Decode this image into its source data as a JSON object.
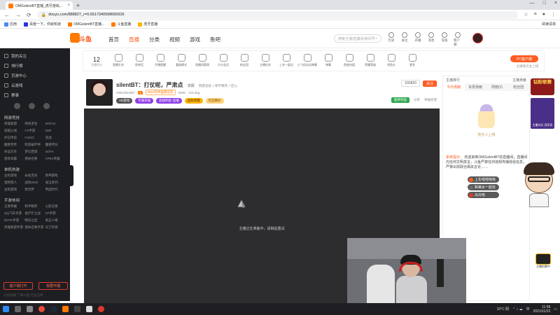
{
  "browser": {
    "tab_title": "OMGsilentBT直播_虎牙游戏...",
    "url": "douyu.com/888827_r=0.6517340598065926",
    "bookmarks": [
      "应用",
      "百度一下，你就知道",
      "OMGsilentBT直播...",
      "斗鱼直播",
      "虎牙直播"
    ],
    "reading_list": "阅读清单"
  },
  "header": {
    "logo": "斗鱼",
    "nav": [
      "首页",
      "直播",
      "分类",
      "视频",
      "游戏",
      "鱼吧"
    ],
    "search_placeholder": "搜索主播/直播间/房间号",
    "icons": [
      {
        "label": "历史",
        "icon": "history-icon"
      },
      {
        "label": "关注",
        "icon": "follow-icon"
      },
      {
        "label": "开播",
        "icon": "broadcast-icon"
      },
      {
        "label": "消息",
        "icon": "message-icon"
      },
      {
        "label": "充值",
        "icon": "wallet-icon"
      },
      {
        "label": "客户端",
        "icon": "client-icon"
      }
    ]
  },
  "sidebar": {
    "items": [
      "我的关注",
      "排行榜",
      "页游中心",
      "云游戏",
      "赛事"
    ],
    "sec_hot": "网游竞技",
    "hot_games": [
      "英雄联盟",
      "绝地求生",
      "DOTA2",
      "穿越火线",
      "CF手游",
      "DNF",
      "炉石传说",
      "CSGO",
      "逆战",
      "魔兽世界",
      "暗黑破坏神",
      "魔兽怀旧",
      "命运方舟",
      "梦幻西游",
      "DOTA",
      "星际争霸",
      "使命召唤",
      "APEX英雄"
    ],
    "sec_single": "单机热游",
    "single_games": [
      "主机游戏",
      "永劫无间",
      "原神游戏",
      "怪物猎人",
      "战地2042",
      "鬼泣系列",
      "主机游戏",
      "新世界",
      "帝国时代"
    ],
    "sec_mobile": "手游休闲",
    "mobile_games": [
      "王者荣耀",
      "和平精英",
      "火影忍者",
      "QQ飞车手游",
      "金铲铲之战",
      "CF手游",
      "DOTA手游",
      "明日之后",
      "第五人格",
      "英雄联盟手游",
      "使命召唤手游",
      "天刀手游"
    ],
    "btn_client": "客户端打开",
    "btn_recruit": "我要开播",
    "footer": "斗鱼招募 了解斗鱼  行业自律"
  },
  "catbar": {
    "history_count": "12",
    "history_label": "主播积分",
    "items": [
      "直播开关",
      "鱼吧话",
      "开播提醒",
      "看剧模式",
      "直播间管理",
      "大众会员",
      "粉丝团",
      "主播任务",
      "上车一起玩",
      "小飞机自动弹幕",
      "弹幕",
      "鱼翅充值",
      "荣耀等级",
      "领鱼丸",
      "更多"
    ],
    "pc_btn": "PC客户端",
    "pc_sub": "主播端点此上线"
  },
  "room": {
    "title": "silentBT：打仗呢，严肃点",
    "report": "举报",
    "crumbs": "网游竞技 > 和平精英 > 匠心",
    "host": "OMGsilentBT",
    "level": "4",
    "honor": "2018年终盛典冠军",
    "team": "OMG",
    "hot": "215.2kg",
    "badges": [
      "VR游戏",
      "专属荣誉",
      "超级明星·直播",
      "超鲜明鑫",
      "玩出精彩"
    ],
    "count": "292820",
    "follow": "关注",
    "share": "分享",
    "report_btn": "举报反馈",
    "green_btn": "超神奖励"
  },
  "player": {
    "loading_text": "主播正在准备中，请稍后重试"
  },
  "rpanel": {
    "head_left": "主播排行",
    "head_right": "主播贡献",
    "tabs": [
      "今日贡献",
      "本周贡献",
      "周榜(2)",
      "粉丝团"
    ],
    "empty_text": "暂无人上榜",
    "chat_sys": "系统提示：",
    "chat_text": "欢迎来到OMGsilentBT的直播间，直播间内任何文明发言，斗鱼严禁任何违规传播低俗信息，严禁出现政治相关言论……",
    "chat_bubble_1": "上车啦啦哈哈",
    "chat_bubble_2": "和美女一起玩",
    "chat_bubble_3": "瓜瓜哈"
  },
  "promo": {
    "title": "钻粉联赛",
    "caption": "主播抖乐 冠军奖"
  },
  "mini_badge": "主播招募中",
  "taskbar": {
    "weather": "10°C 阴",
    "lang": "中",
    "time": "11:58",
    "date": "2021/11/22"
  },
  "colors": {
    "accent": "#ff5d23",
    "sidebar_bg": "#1d1e22",
    "player_bg": "#2d2d2f"
  }
}
